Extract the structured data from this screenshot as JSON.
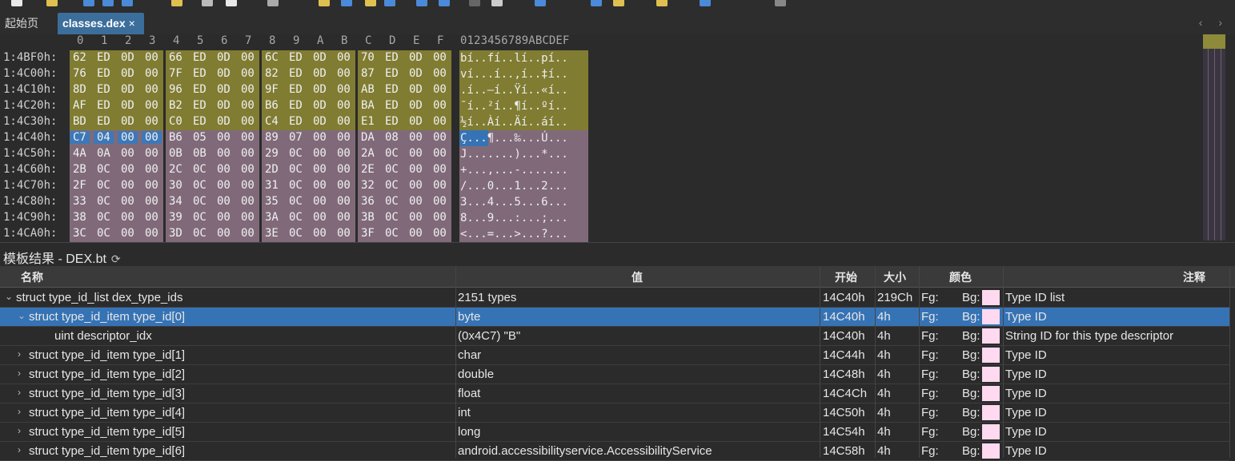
{
  "tabs": {
    "home": "起始页",
    "active": "classes.dex",
    "close": "×"
  },
  "nav": {
    "arrows": "‹ ›"
  },
  "hex": {
    "header_cols": [
      "0",
      "1",
      "2",
      "3",
      "4",
      "5",
      "6",
      "7",
      "8",
      "9",
      "A",
      "B",
      "C",
      "D",
      "E",
      "F"
    ],
    "ascii_header": "0123456789ABCDEF",
    "rows": [
      {
        "addr": "1:4BF0h:",
        "bytes": [
          "62",
          "ED",
          "0D",
          "00",
          "66",
          "ED",
          "0D",
          "00",
          "6C",
          "ED",
          "0D",
          "00",
          "70",
          "ED",
          "0D",
          "00"
        ],
        "ascii": "bí..fí..lí..pí..",
        "color": "#807c32"
      },
      {
        "addr": "1:4C00h:",
        "bytes": [
          "76",
          "ED",
          "0D",
          "00",
          "7F",
          "ED",
          "0D",
          "00",
          "82",
          "ED",
          "0D",
          "00",
          "87",
          "ED",
          "0D",
          "00"
        ],
        "ascii": "ví...í..‚í..‡í..",
        "color": "#807c32"
      },
      {
        "addr": "1:4C10h:",
        "bytes": [
          "8D",
          "ED",
          "0D",
          "00",
          "96",
          "ED",
          "0D",
          "00",
          "9F",
          "ED",
          "0D",
          "00",
          "AB",
          "ED",
          "0D",
          "00"
        ],
        "ascii": ".í..–í..Ÿí..«í..",
        "color": "#807c32"
      },
      {
        "addr": "1:4C20h:",
        "bytes": [
          "AF",
          "ED",
          "0D",
          "00",
          "B2",
          "ED",
          "0D",
          "00",
          "B6",
          "ED",
          "0D",
          "00",
          "BA",
          "ED",
          "0D",
          "00"
        ],
        "ascii": "¯í..²í..¶í..ºí..",
        "color": "#807c32"
      },
      {
        "addr": "1:4C30h:",
        "bytes": [
          "BD",
          "ED",
          "0D",
          "00",
          "C0",
          "ED",
          "0D",
          "00",
          "C4",
          "ED",
          "0D",
          "00",
          "E1",
          "ED",
          "0D",
          "00"
        ],
        "ascii": "½í..Àí..Äí..áí..",
        "color": "#807c32"
      },
      {
        "addr": "1:4C40h:",
        "bytes": [
          "C7",
          "04",
          "00",
          "00",
          "B6",
          "05",
          "00",
          "00",
          "89",
          "07",
          "00",
          "00",
          "DA",
          "08",
          "00",
          "00"
        ],
        "ascii": "Ç...¶...‰...Ú...",
        "color": "#806a7a"
      },
      {
        "addr": "1:4C50h:",
        "bytes": [
          "4A",
          "0A",
          "00",
          "00",
          "0B",
          "0B",
          "00",
          "00",
          "29",
          "0C",
          "00",
          "00",
          "2A",
          "0C",
          "00",
          "00"
        ],
        "ascii": "J.......)...*...",
        "color": "#806a7a"
      },
      {
        "addr": "1:4C60h:",
        "bytes": [
          "2B",
          "0C",
          "00",
          "00",
          "2C",
          "0C",
          "00",
          "00",
          "2D",
          "0C",
          "00",
          "00",
          "2E",
          "0C",
          "00",
          "00"
        ],
        "ascii": "+...,...-.......",
        "color": "#806a7a"
      },
      {
        "addr": "1:4C70h:",
        "bytes": [
          "2F",
          "0C",
          "00",
          "00",
          "30",
          "0C",
          "00",
          "00",
          "31",
          "0C",
          "00",
          "00",
          "32",
          "0C",
          "00",
          "00"
        ],
        "ascii": "/...0...1...2...",
        "color": "#806a7a"
      },
      {
        "addr": "1:4C80h:",
        "bytes": [
          "33",
          "0C",
          "00",
          "00",
          "34",
          "0C",
          "00",
          "00",
          "35",
          "0C",
          "00",
          "00",
          "36",
          "0C",
          "00",
          "00"
        ],
        "ascii": "3...4...5...6...",
        "color": "#806a7a"
      },
      {
        "addr": "1:4C90h:",
        "bytes": [
          "38",
          "0C",
          "00",
          "00",
          "39",
          "0C",
          "00",
          "00",
          "3A",
          "0C",
          "00",
          "00",
          "3B",
          "0C",
          "00",
          "00"
        ],
        "ascii": "8...9...:...;...",
        "color": "#806a7a"
      },
      {
        "addr": "1:4CA0h:",
        "bytes": [
          "3C",
          "0C",
          "00",
          "00",
          "3D",
          "0C",
          "00",
          "00",
          "3E",
          "0C",
          "00",
          "00",
          "3F",
          "0C",
          "00",
          "00"
        ],
        "ascii": "<...=...>...?...",
        "color": "#806a7a"
      }
    ],
    "selected_row": 5,
    "selected_bytes": 4
  },
  "template": {
    "title": "模板结果 - DEX.bt",
    "refresh_icon": "⟳"
  },
  "grid": {
    "columns": {
      "name": "名称",
      "value": "值",
      "start": "开始",
      "size": "大小",
      "color": "颜色",
      "comment": "注释"
    },
    "rows": [
      {
        "name": "struct type_id_list dex_type_ids",
        "value": "2151 types",
        "start": "14C40h",
        "size": "219Ch",
        "fg": "Fg:",
        "bg": "Bg:",
        "comment": "Type ID list",
        "indent": 0,
        "chev": "expanded"
      },
      {
        "name": "struct type_id_item type_id[0]",
        "value": "byte",
        "start": "14C40h",
        "size": "4h",
        "fg": "Fg:",
        "bg": "Bg:",
        "comment": "Type ID",
        "indent": 1,
        "chev": "expanded",
        "selected": true
      },
      {
        "name": "uint descriptor_idx",
        "value": "(0x4C7) \"B\"",
        "start": "14C40h",
        "size": "4h",
        "fg": "Fg:",
        "bg": "Bg:",
        "comment": "String ID for this type descriptor",
        "indent": 2,
        "chev": "none"
      },
      {
        "name": "struct type_id_item type_id[1]",
        "value": "char",
        "start": "14C44h",
        "size": "4h",
        "fg": "Fg:",
        "bg": "Bg:",
        "comment": "Type ID",
        "indent": 1,
        "chev": "collapsed"
      },
      {
        "name": "struct type_id_item type_id[2]",
        "value": "double",
        "start": "14C48h",
        "size": "4h",
        "fg": "Fg:",
        "bg": "Bg:",
        "comment": "Type ID",
        "indent": 1,
        "chev": "collapsed"
      },
      {
        "name": "struct type_id_item type_id[3]",
        "value": "float",
        "start": "14C4Ch",
        "size": "4h",
        "fg": "Fg:",
        "bg": "Bg:",
        "comment": "Type ID",
        "indent": 1,
        "chev": "collapsed"
      },
      {
        "name": "struct type_id_item type_id[4]",
        "value": "int",
        "start": "14C50h",
        "size": "4h",
        "fg": "Fg:",
        "bg": "Bg:",
        "comment": "Type ID",
        "indent": 1,
        "chev": "collapsed"
      },
      {
        "name": "struct type_id_item type_id[5]",
        "value": "long",
        "start": "14C54h",
        "size": "4h",
        "fg": "Fg:",
        "bg": "Bg:",
        "comment": "Type ID",
        "indent": 1,
        "chev": "collapsed"
      },
      {
        "name": "struct type_id_item type_id[6]",
        "value": "android.accessibilityservice.AccessibilityService",
        "start": "14C58h",
        "size": "4h",
        "fg": "Fg:",
        "bg": "Bg:",
        "comment": "Type ID",
        "indent": 1,
        "chev": "collapsed"
      }
    ]
  },
  "colors": {
    "selection": "#3673b5",
    "bg_swatch": "#ffd9ef",
    "olive": "#807c32",
    "mauve": "#806a7a"
  }
}
